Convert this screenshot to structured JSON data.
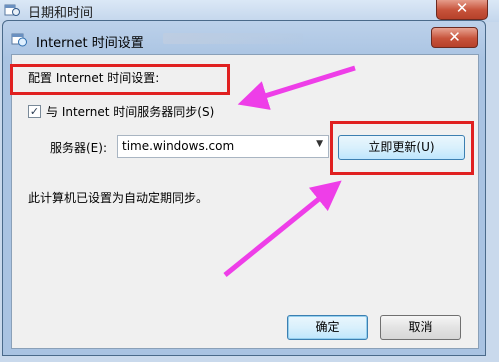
{
  "parent_window": {
    "title": "日期和时间",
    "close_label": "✕"
  },
  "dialog": {
    "title": "Internet 时间设置",
    "close_label": "✕",
    "heading": "配置 Internet 时间设置:",
    "sync_label": "与 Internet 时间服务器同步(S)",
    "sync_checked": true,
    "server_label": "服务器(E):",
    "server_value": "time.windows.com",
    "update_button": "立即更新(U)",
    "status_text": "此计算机已设置为自动定期同步。",
    "ok_button": "确定",
    "cancel_button": "取消"
  },
  "colors": {
    "highlight": "#e02020",
    "arrow": "#ee3ee8",
    "button_focus": "#3c7fb1"
  }
}
